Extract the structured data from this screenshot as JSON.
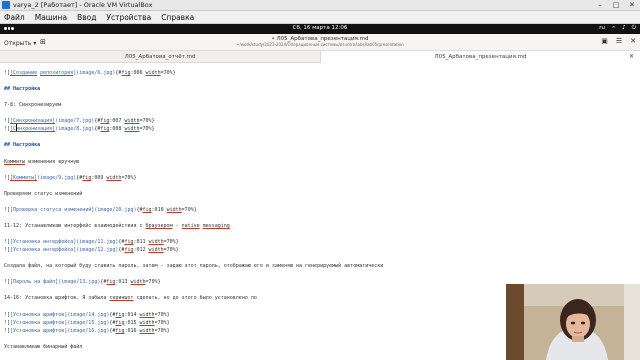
{
  "vbox": {
    "title": "varya_2 [Работает] - Oracle VM VirtualBox",
    "menu": [
      "Файл",
      "Машина",
      "Ввод",
      "Устройства",
      "Справка"
    ]
  },
  "gnome": {
    "clock": "Сб, 16 марта  12:06",
    "tray_lang": "ru"
  },
  "editor": {
    "open_label": "Открыть",
    "title": "• Л05_Арбатова_презентация.md",
    "path": "~/work/study/2023-2024/Операционные системы/os-intro/labs/lab05/presentation",
    "tabs": [
      {
        "label": "Л05_Арбатова_отчёт.md"
      },
      {
        "label": "Л05_Арбатова_презентация.md"
      }
    ],
    "lines": [
      [
        [
          "t",
          "!["
        ],
        [
          "lk ul",
          "[Создание"
        ],
        [
          "lk",
          " "
        ],
        [
          "lk ul",
          "репозитория"
        ],
        [
          "lk",
          "]"
        ],
        [
          "lk",
          "(image/6.jpg)"
        ],
        [
          "t",
          "{#"
        ],
        [
          "t ul",
          "fig"
        ],
        [
          "t",
          ":006 "
        ],
        [
          "t ul",
          "width"
        ],
        [
          "t",
          "=70%}"
        ]
      ],
      [],
      [
        [
          "hd",
          "## Настройка"
        ]
      ],
      [],
      [
        [
          "t",
          "7-8: Синхронизируем"
        ]
      ],
      [],
      [
        [
          "t",
          "!["
        ],
        [
          "lk ul",
          "[Синхронизация]"
        ],
        [
          "lk",
          "(image/7.jpg)"
        ],
        [
          "t",
          "{#"
        ],
        [
          "t ul",
          "fig"
        ],
        [
          "t",
          ":007 "
        ],
        [
          "t ul",
          "width"
        ],
        [
          "t",
          "=70%}"
        ]
      ],
      [
        [
          "t",
          "!["
        ],
        [
          "lk ul",
          "[Синхронизация]"
        ],
        [
          "lk",
          "(image/8.jpg)"
        ],
        [
          "t",
          "{#"
        ],
        [
          "t ul",
          "fig"
        ],
        [
          "t",
          ":008 "
        ],
        [
          "t ul",
          "width"
        ],
        [
          "t",
          "=70%}"
        ]
      ],
      [],
      [
        [
          "hd",
          "## Настройка"
        ]
      ],
      [],
      [
        [
          "t ul",
          "Коммиты"
        ],
        [
          "t",
          " изменения вручную"
        ]
      ],
      [],
      [
        [
          "t",
          "!["
        ],
        [
          "lk ul",
          "[Коммиты]"
        ],
        [
          "lk",
          "(image/9.jpg)"
        ],
        [
          "t",
          "{#"
        ],
        [
          "t ul",
          "fig"
        ],
        [
          "t",
          ":009 "
        ],
        [
          "t ul",
          "width"
        ],
        [
          "t",
          "=70%}"
        ]
      ],
      [],
      [
        [
          "t",
          "Проверяем статус изменений"
        ]
      ],
      [],
      [
        [
          "t",
          "!["
        ],
        [
          "lk",
          "[Проверка статуса изменений]"
        ],
        [
          "lk",
          "(image/10.jpg)"
        ],
        [
          "t",
          "{#"
        ],
        [
          "t ul",
          "fig"
        ],
        [
          "t",
          ":010 "
        ],
        [
          "t ul",
          "width"
        ],
        [
          "t",
          "=70%}"
        ]
      ],
      [],
      [
        [
          "t",
          "11-12: Устанавливаю интерфейс взаимодействия с "
        ],
        [
          "t ul",
          "браузером"
        ],
        [
          "t",
          " - "
        ],
        [
          "t ul",
          "native"
        ],
        [
          "t",
          " "
        ],
        [
          "t ul",
          "messaging"
        ]
      ],
      [],
      [
        [
          "t",
          "!["
        ],
        [
          "lk",
          "[Установка интерфейса]"
        ],
        [
          "lk",
          "(image/11.jpg)"
        ],
        [
          "t",
          "{#"
        ],
        [
          "t ul",
          "fig"
        ],
        [
          "t",
          ":011 "
        ],
        [
          "t ul",
          "width"
        ],
        [
          "t",
          "=70%}"
        ]
      ],
      [
        [
          "t",
          "!["
        ],
        [
          "lk",
          "[Установка интерфейса]"
        ],
        [
          "lk",
          "(image/12.jpg)"
        ],
        [
          "t",
          "{#"
        ],
        [
          "t ul",
          "fig"
        ],
        [
          "t",
          ":012 "
        ],
        [
          "t ul",
          "width"
        ],
        [
          "t",
          "=70%}"
        ]
      ],
      [],
      [
        [
          "t",
          "Создала файл, на который буду ставить пароль, затем - задаю этот пароль, отображаю его и заменяю на генерируемый автоматически"
        ]
      ],
      [],
      [
        [
          "t",
          "!["
        ],
        [
          "lk",
          "[Пароль на   файл]"
        ],
        [
          "lk",
          "(image/13.jpg)"
        ],
        [
          "t",
          "{#"
        ],
        [
          "t ul",
          "fig"
        ],
        [
          "t",
          ":013 "
        ],
        [
          "t ul",
          "width"
        ],
        [
          "t",
          "=70%}"
        ]
      ],
      [],
      [
        [
          "t",
          "14-16: Установка шрифтов. Я забыла "
        ],
        [
          "t ul",
          "скриншот"
        ],
        [
          "t",
          " сделать, но до этого было установлено по"
        ]
      ],
      [],
      [
        [
          "t",
          "!["
        ],
        [
          "lk",
          "[Установка шрифтов]"
        ],
        [
          "lk",
          "(image/14.jpg)"
        ],
        [
          "t",
          "{#"
        ],
        [
          "t ul",
          "fig"
        ],
        [
          "t",
          ":014 "
        ],
        [
          "t ul",
          "width"
        ],
        [
          "t",
          "=70%}"
        ]
      ],
      [
        [
          "t",
          "!["
        ],
        [
          "lk",
          "[Установка шрифтов]"
        ],
        [
          "lk",
          "(image/15.jpg)"
        ],
        [
          "t",
          "{#"
        ],
        [
          "t ul",
          "fig"
        ],
        [
          "t",
          ":015 "
        ],
        [
          "t ul",
          "width"
        ],
        [
          "t",
          "=70%}"
        ]
      ],
      [
        [
          "t",
          "!["
        ],
        [
          "lk",
          "[Установка шрифтов]"
        ],
        [
          "lk",
          "(image/16.jpg)"
        ],
        [
          "t",
          "{#"
        ],
        [
          "t ul",
          "fig"
        ],
        [
          "t",
          ":016 "
        ],
        [
          "t ul",
          "width"
        ],
        [
          "t",
          "=70%}"
        ]
      ],
      [],
      [
        [
          "t",
          "Устанавливаю бинарный файл"
        ]
      ]
    ]
  }
}
